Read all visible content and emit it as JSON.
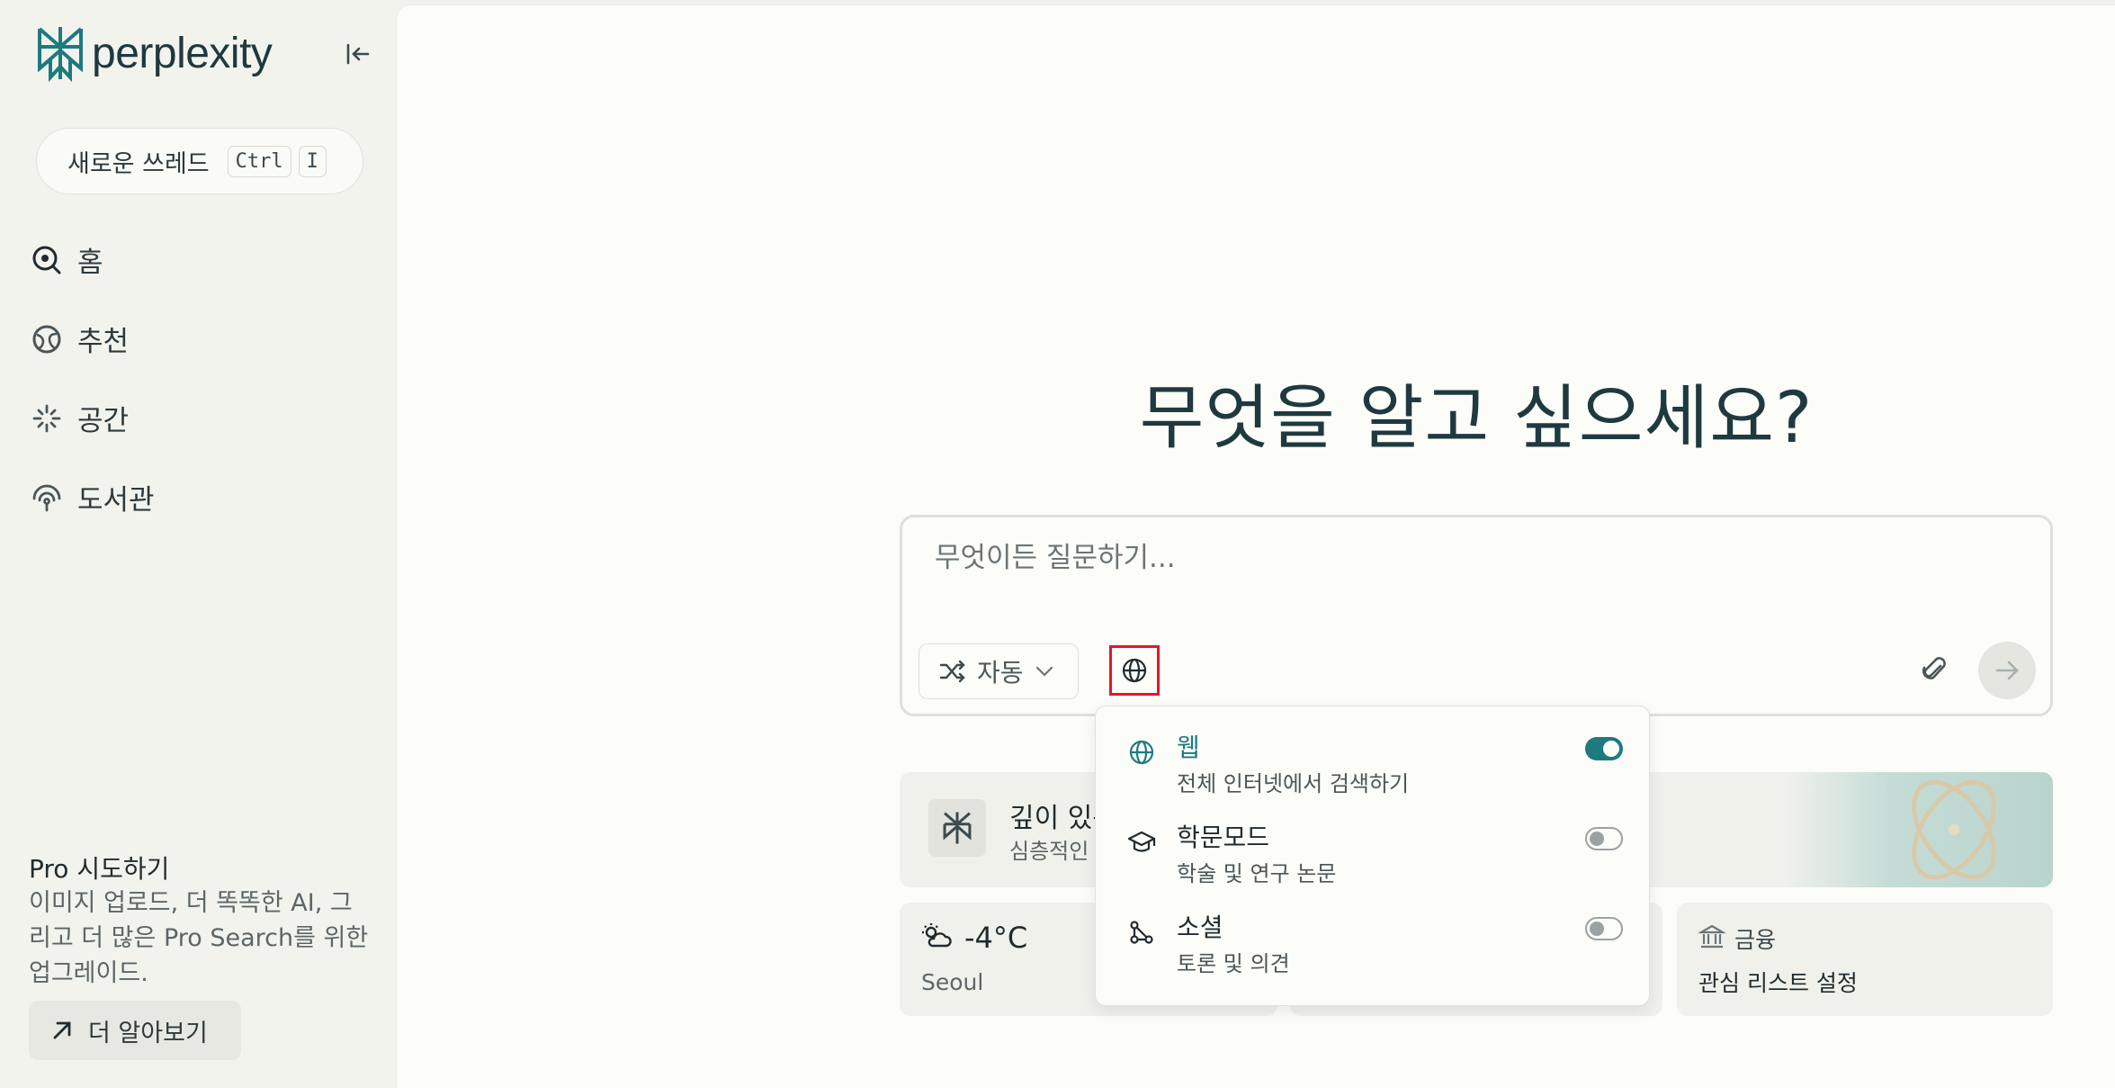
{
  "brand": {
    "name": "perplexity",
    "accent": "#1d7a7f"
  },
  "sidebar": {
    "new_thread": {
      "label": "새로운 쓰레드",
      "shortcut_1": "Ctrl",
      "shortcut_2": "I"
    },
    "items": [
      {
        "label": "홈",
        "icon": "home-icon"
      },
      {
        "label": "추천",
        "icon": "discover-icon"
      },
      {
        "label": "공간",
        "icon": "spaces-icon"
      },
      {
        "label": "도서관",
        "icon": "library-icon"
      }
    ],
    "pro": {
      "title": "Pro 시도하기",
      "description": "이미지 업로드, 더 똑똑한 AI, 그리고 더 많은 Pro Search를 위한 업그레이드.",
      "button": "더 알아보기"
    }
  },
  "main": {
    "headline": "무엇을 알고 싶으세요?",
    "search": {
      "placeholder": "무엇이든 질문하기...",
      "mode_label": "자동"
    },
    "focus_menu": [
      {
        "label": "웹",
        "description": "전체 인터넷에서 검색하기",
        "enabled": true,
        "icon": "globe-icon"
      },
      {
        "label": "학문모드",
        "description": "학술 및 연구 논문",
        "enabled": false,
        "icon": "graduation-cap-icon"
      },
      {
        "label": "소셜",
        "description": "토론 및 의견",
        "enabled": false,
        "icon": "social-network-icon"
      }
    ],
    "promo_card": {
      "title": "깊이 있는",
      "subtitle": "심층적인"
    },
    "weather": {
      "temp": "-4°C",
      "city": "Seoul"
    },
    "finance": {
      "label": "금융",
      "subtitle": "관심 리스트 설정"
    }
  }
}
